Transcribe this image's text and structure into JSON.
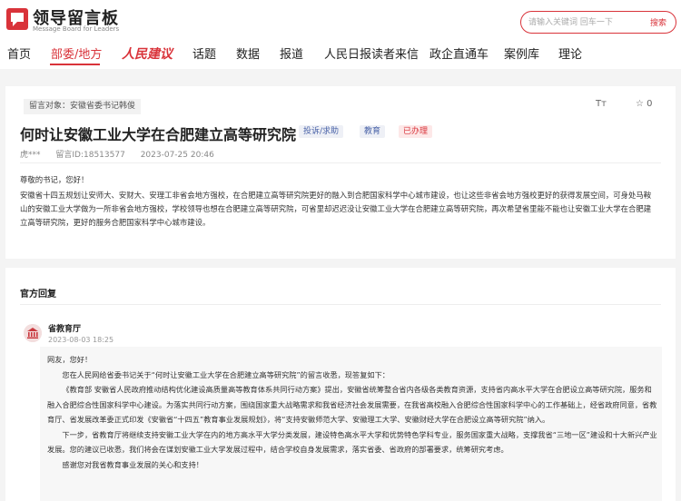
{
  "header": {
    "logo_title": "领导留言板",
    "logo_subtitle": "Message Board for Leaders",
    "search_placeholder": "请输入关键词 回车一下",
    "search_button": "搜索"
  },
  "nav": {
    "items": [
      {
        "label": "首页"
      },
      {
        "label": "部委/地方",
        "active": true
      },
      {
        "label": "人民建议"
      },
      {
        "label": "话题"
      },
      {
        "label": "数据"
      },
      {
        "label": "报道"
      },
      {
        "label": "人民日报读者来信"
      },
      {
        "label": "政企直通车"
      },
      {
        "label": "案例库"
      },
      {
        "label": "理论"
      }
    ]
  },
  "message": {
    "target": "留言对象：安徽省委书记韩俊",
    "title": "何时让安徽工业大学在合肥建立高等研究院",
    "tags": {
      "type": "投诉/求助",
      "field": "教育",
      "status": "已办理"
    },
    "author": "虎***",
    "id": "留言ID:18513577",
    "date": "2023-07-25 20:46",
    "font_label": "Tт",
    "likes": "0",
    "greeting": "尊敬的书记，您好！",
    "body": "安徽省十四五规划让安师大、安财大、安理工非省会地方强校，在合肥建立高等研究院更好的融入到合肥国家科学中心城市建设，也让这些非省会地方强校更好的获得发展空间，可身处马鞍山的安徽工业大学做为一所非省会地方强校，学校领导也想在合肥建立高等研究院，可省里却迟迟没让安徽工业大学在合肥建立高等研究院，再次希望省里能不能也让安徽工业大学在合肥建立高等研究院，更好的服务合肥国家科学中心城市建设。"
  },
  "reply": {
    "section_title": "官方回复",
    "org": "省教育厅",
    "date": "2023-08-03 18:25",
    "paragraphs": [
      "网友，您好！",
      "您在人民网给省委书记关于“何时让安徽工业大学在合肥建立高等研究院”的留言收悉，现答复如下：",
      "《教育部 安徽省人民政府推动结构优化建设高质量高等教育体系共同行动方案》提出，安徽省统筹整合省内各级各类教育资源，支持省内高水平大学在合肥设立高等研究院，服务和融入合肥综合性国家科学中心建设。为落实共同行动方案，围绕国家重大战略需求和我省经济社会发展需要，在我省高校融入合肥综合性国家科学中心的工作基础上，经省政府同意，省教育厅、省发展改革委正式印发《安徽省“十四五”教育事业发展规划》，将“支持安徽师范大学、安徽理工大学、安徽财经大学在合肥设立高等研究院”纳入。",
      "下一步，省教育厅将继续支持安徽工业大学在内的地方高水平大学分类发展，建设特色高水平大学和优势特色学科专业，服务国家重大战略，支撑我省“三地一区”建设和十大新兴产业发展。您的建议已收悉，我们将会在谋划安徽工业大学发展过程中，结合学校自身发展需求，落实省委、省政府的部署要求，统筹研究考虑。",
      "感谢您对我省教育事业发展的关心和支持！"
    ]
  },
  "colors": {
    "accent": "#d9333a",
    "tag_blue": "#4a63a8"
  },
  "icons": [
    "logo-icon",
    "font-size-icon",
    "star-icon",
    "org-building-icon"
  ]
}
